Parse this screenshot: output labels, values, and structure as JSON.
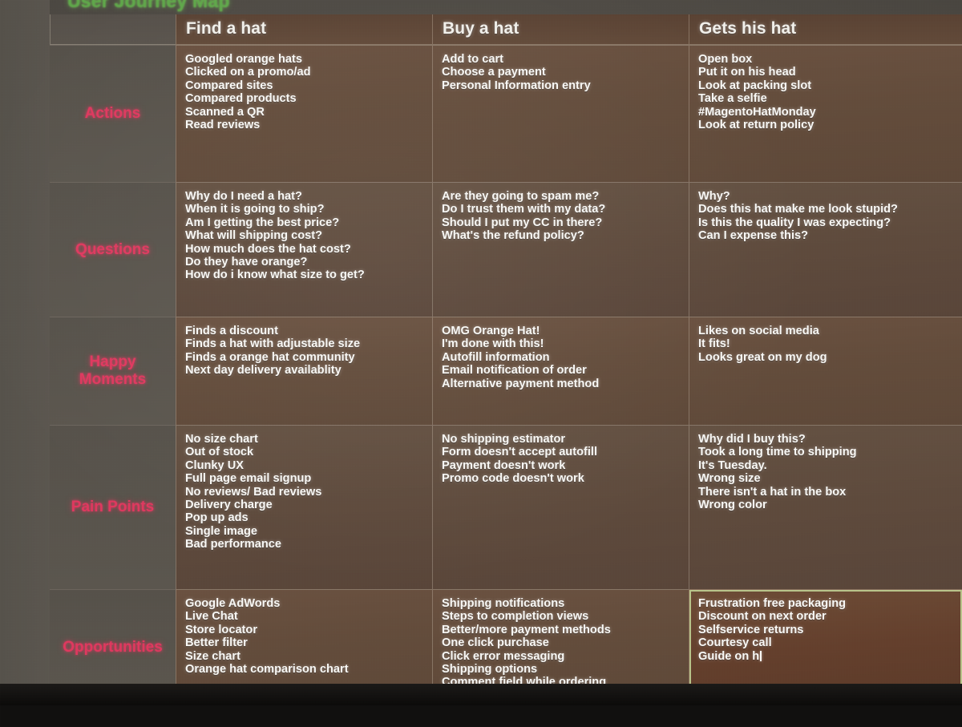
{
  "slide": {
    "title": "User Journey Map",
    "title_color": "#5fa84a",
    "row_label_color": "#e0385f",
    "header_band_color": "#5a4233",
    "cell_color": "#634c3b",
    "selection_border_color": "#b9c48a"
  },
  "table": {
    "corner_label": "",
    "columns": [
      {
        "label": "Find a hat"
      },
      {
        "label": "Buy a hat"
      },
      {
        "label": "Gets his hat"
      }
    ],
    "rows": [
      {
        "label": "Actions",
        "cells": [
          {
            "items": [
              "Googled orange hats",
              "Clicked on a promo/ad",
              "Compared sites",
              "Compared products",
              "Scanned a QR",
              "Read reviews"
            ]
          },
          {
            "items": [
              "Add to cart",
              "Choose a payment",
              "Personal Information entry"
            ]
          },
          {
            "items": [
              "Open box",
              "Put it on his head",
              "Look at packing slot",
              "Take a selfie",
              "#MagentoHatMonday",
              "Look at return policy"
            ]
          }
        ]
      },
      {
        "label": "Questions",
        "cells": [
          {
            "items": [
              "Why do I need a hat?",
              "When it is going to ship?",
              "Am I getting the best price?",
              "What will shipping cost?",
              "How much does the hat cost?",
              "Do they have orange?",
              "How do i know what size to get?"
            ]
          },
          {
            "items": [
              "Are they going to spam me?",
              "Do I trust them with my data?",
              "Should I put my CC in there?",
              "What's the refund policy?"
            ]
          },
          {
            "items": [
              "Why?",
              "Does this hat make me look stupid?",
              "Is this the quality I was expecting?",
              "Can I expense this?"
            ]
          }
        ]
      },
      {
        "label": "Happy\nMoments",
        "label_line1": "Happy",
        "label_line2": "Moments",
        "cells": [
          {
            "items": [
              "Finds a discount",
              "Finds a hat with adjustable size",
              "Finds a orange hat community",
              "Next day delivery availablity"
            ]
          },
          {
            "items": [
              "OMG Orange Hat!",
              "I'm done with this!",
              "Autofill information",
              "Email notification of order",
              "Alternative payment method"
            ]
          },
          {
            "items": [
              "Likes on social media",
              "It fits!",
              "Looks great on my dog"
            ]
          }
        ]
      },
      {
        "label": "Pain Points",
        "cells": [
          {
            "items": [
              "No size chart",
              "Out of stock",
              "Clunky UX",
              "Full page email signup",
              "No reviews/ Bad reviews",
              "Delivery charge",
              "Pop up ads",
              "Single image",
              "Bad performance"
            ]
          },
          {
            "items": [
              "No shipping estimator",
              "Form doesn't accept autofill",
              "Payment doesn't work",
              "Promo code doesn't work"
            ]
          },
          {
            "items": [
              "Why did I buy this?",
              "Took a long time to shipping",
              "It's Tuesday.",
              "Wrong size",
              "There isn't a hat in the box",
              "Wrong color"
            ]
          }
        ]
      },
      {
        "label": "Opportunities",
        "cells": [
          {
            "items": [
              "Google AdWords",
              "Live Chat",
              "Store locator",
              "Better filter",
              "Size chart",
              "Orange hat comparison chart"
            ]
          },
          {
            "items": [
              "Shipping notifications",
              "Steps to completion views",
              "Better/more payment methods",
              "One click purchase",
              "Click error messaging",
              "Shipping options",
              "Comment field while ordering"
            ]
          },
          {
            "selected": true,
            "editing": true,
            "items": [
              "Frustration free packaging",
              "Discount on next order",
              "Selfservice returns",
              "Courtesy call",
              "Guide on h"
            ]
          }
        ]
      }
    ]
  }
}
